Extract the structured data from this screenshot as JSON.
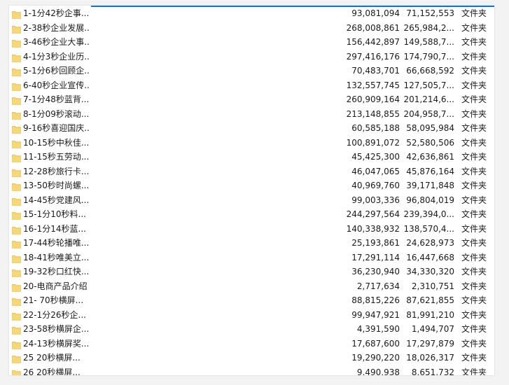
{
  "files": [
    {
      "name": "1-1分42秒企事...",
      "size": "93,081,094",
      "compressed": "71,152,553",
      "type": "文件夹"
    },
    {
      "name": "2-38秒企业发展...",
      "size": "268,008,861",
      "compressed": "265,984,2...",
      "type": "文件夹"
    },
    {
      "name": "3-46秒企业大事...",
      "size": "156,442,897",
      "compressed": "149,588,7...",
      "type": "文件夹"
    },
    {
      "name": "4-1分3秒企业历...",
      "size": "297,416,176",
      "compressed": "174,790,7...",
      "type": "文件夹"
    },
    {
      "name": "5-1分6秒回顾企...",
      "size": "70,483,701",
      "compressed": "66,668,592",
      "type": "文件夹"
    },
    {
      "name": "6-40秒企业宣传...",
      "size": "132,557,745",
      "compressed": "127,505,7...",
      "type": "文件夹"
    },
    {
      "name": "7-1分48秒蓝背...",
      "size": "260,909,164",
      "compressed": "201,214,6...",
      "type": "文件夹"
    },
    {
      "name": "8-1分09秒滚动...",
      "size": "213,148,855",
      "compressed": "204,958,7...",
      "type": "文件夹"
    },
    {
      "name": "9-16秒喜迎国庆...",
      "size": "60,585,188",
      "compressed": "58,095,984",
      "type": "文件夹"
    },
    {
      "name": "10-15秒中秋佳...",
      "size": "100,891,072",
      "compressed": "52,580,506",
      "type": "文件夹"
    },
    {
      "name": "11-15秒五劳动...",
      "size": "45,425,300",
      "compressed": "42,636,861",
      "type": "文件夹"
    },
    {
      "name": "12-28秒旅行卡...",
      "size": "46,047,065",
      "compressed": "45,876,164",
      "type": "文件夹"
    },
    {
      "name": "13-50秒时尚螺...",
      "size": "40,969,760",
      "compressed": "39,171,848",
      "type": "文件夹"
    },
    {
      "name": "14-45秒党建风...",
      "size": "99,003,336",
      "compressed": "96,804,019",
      "type": "文件夹"
    },
    {
      "name": "15-1分10秒料...",
      "size": "244,297,564",
      "compressed": "239,394,0...",
      "type": "文件夹"
    },
    {
      "name": "16-1分14秒蓝...",
      "size": "140,338,932",
      "compressed": "138,570,4...",
      "type": "文件夹"
    },
    {
      "name": "17-44秒轮播唯...",
      "size": "25,193,861",
      "compressed": "24,628,973",
      "type": "文件夹"
    },
    {
      "name": "18-41秒唯美立...",
      "size": "17,291,114",
      "compressed": "16,447,668",
      "type": "文件夹"
    },
    {
      "name": "19-32秒口红快...",
      "size": "36,230,940",
      "compressed": "34,330,320",
      "type": "文件夹"
    },
    {
      "name": "20-电商产品介绍",
      "size": "2,717,634",
      "compressed": "2,310,751",
      "type": "文件夹"
    },
    {
      "name": "21-  70秒横屏...",
      "size": "88,815,226",
      "compressed": "87,621,855",
      "type": "文件夹"
    },
    {
      "name": "22-1分26秒企...",
      "size": "99,947,921",
      "compressed": "81,991,210",
      "type": "文件夹"
    },
    {
      "name": "23-58秒横屏企...",
      "size": "4,391,590",
      "compressed": "1,494,707",
      "type": "文件夹"
    },
    {
      "name": "24-13秒横屏奖...",
      "size": "17,687,600",
      "compressed": "17,297,879",
      "type": "文件夹"
    },
    {
      "name": "25  20秒横屏...",
      "size": "19,290,220",
      "compressed": "18,026,317",
      "type": "文件夹"
    },
    {
      "name": "26  20秒横屏...",
      "size": "9,490,938",
      "compressed": "8,651,732",
      "type": "文件夹"
    }
  ],
  "icons": {
    "folder": "folder-icon"
  },
  "colors": {
    "folder_fill": "#f8d775",
    "folder_tab": "#e8b84a",
    "accent": "#0a74d8"
  }
}
